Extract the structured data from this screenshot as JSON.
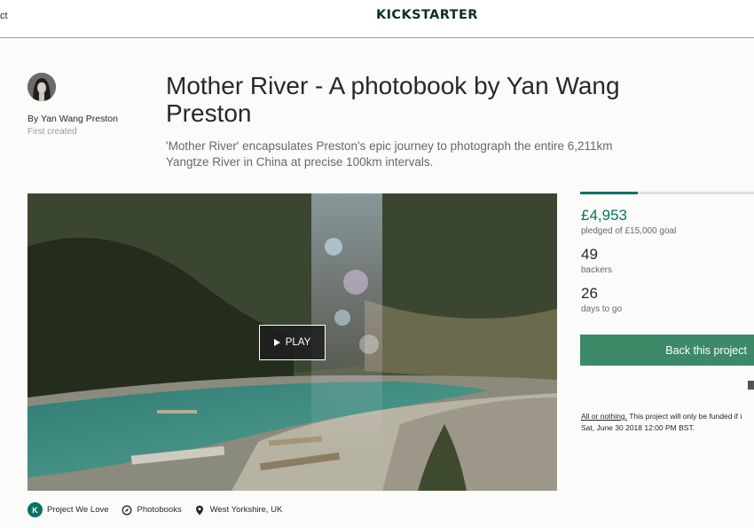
{
  "nav": {
    "left_text": "ct",
    "logo": "KICKSTARTER"
  },
  "creator": {
    "name": "By Yan Wang Preston",
    "subtitle": "First created"
  },
  "project": {
    "title": "Mother River - A photobook by Yan Wang Preston",
    "blurb": "'Mother River' encapsulates Preston's epic journey to photograph the entire 6,211km Yangtze River in China at precise 100km intervals."
  },
  "video": {
    "play_label": "PLAY"
  },
  "stats": {
    "progress_fraction": 0.33,
    "pledged_amount": "£4,953",
    "pledged_label": "pledged of £15,000 goal",
    "backers_count": "49",
    "backers_label": "backers",
    "days_count": "26",
    "days_label": "days to go"
  },
  "actions": {
    "back_label": "Back this project"
  },
  "funding": {
    "link_text": "All or nothing.",
    "line1_rest": " This project will only be funded if i",
    "line2": "Sat, June 30 2018 12:00 PM BST."
  },
  "tags": {
    "pwl_badge": "K",
    "project_we_love": "Project We Love",
    "category": "Photobooks",
    "location": "West Yorkshire, UK"
  },
  "colors": {
    "brand": "#037362",
    "button": "#3c8a67",
    "logo": "#0f2d2d"
  }
}
